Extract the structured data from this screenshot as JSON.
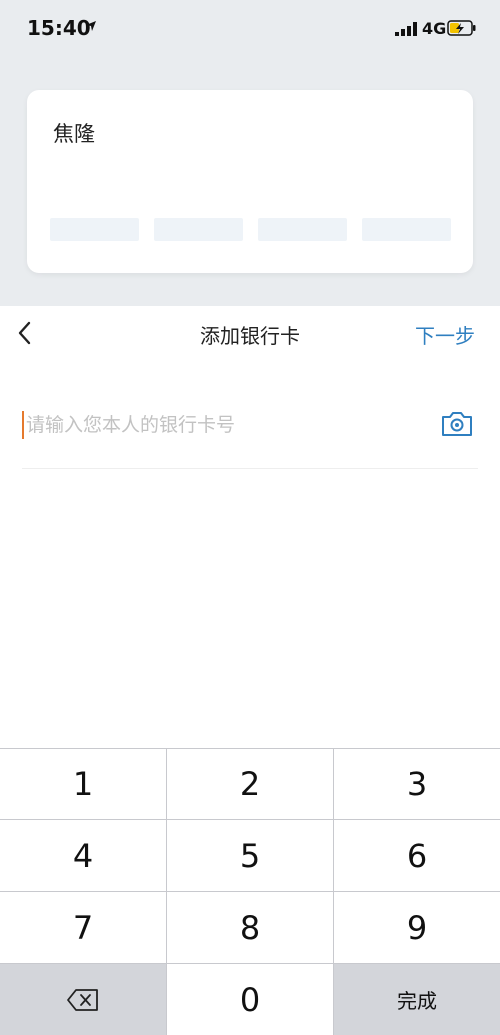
{
  "status": {
    "time": "15:40",
    "network": "4G"
  },
  "card": {
    "holder_name": "焦隆"
  },
  "nav": {
    "title": "添加银行卡",
    "next_label": "下一步"
  },
  "input": {
    "placeholder": "请输入您本人的银行卡号",
    "value": ""
  },
  "keypad": {
    "keys": [
      "1",
      "2",
      "3",
      "4",
      "5",
      "6",
      "7",
      "8",
      "9",
      "0"
    ],
    "done_label": "完成"
  }
}
